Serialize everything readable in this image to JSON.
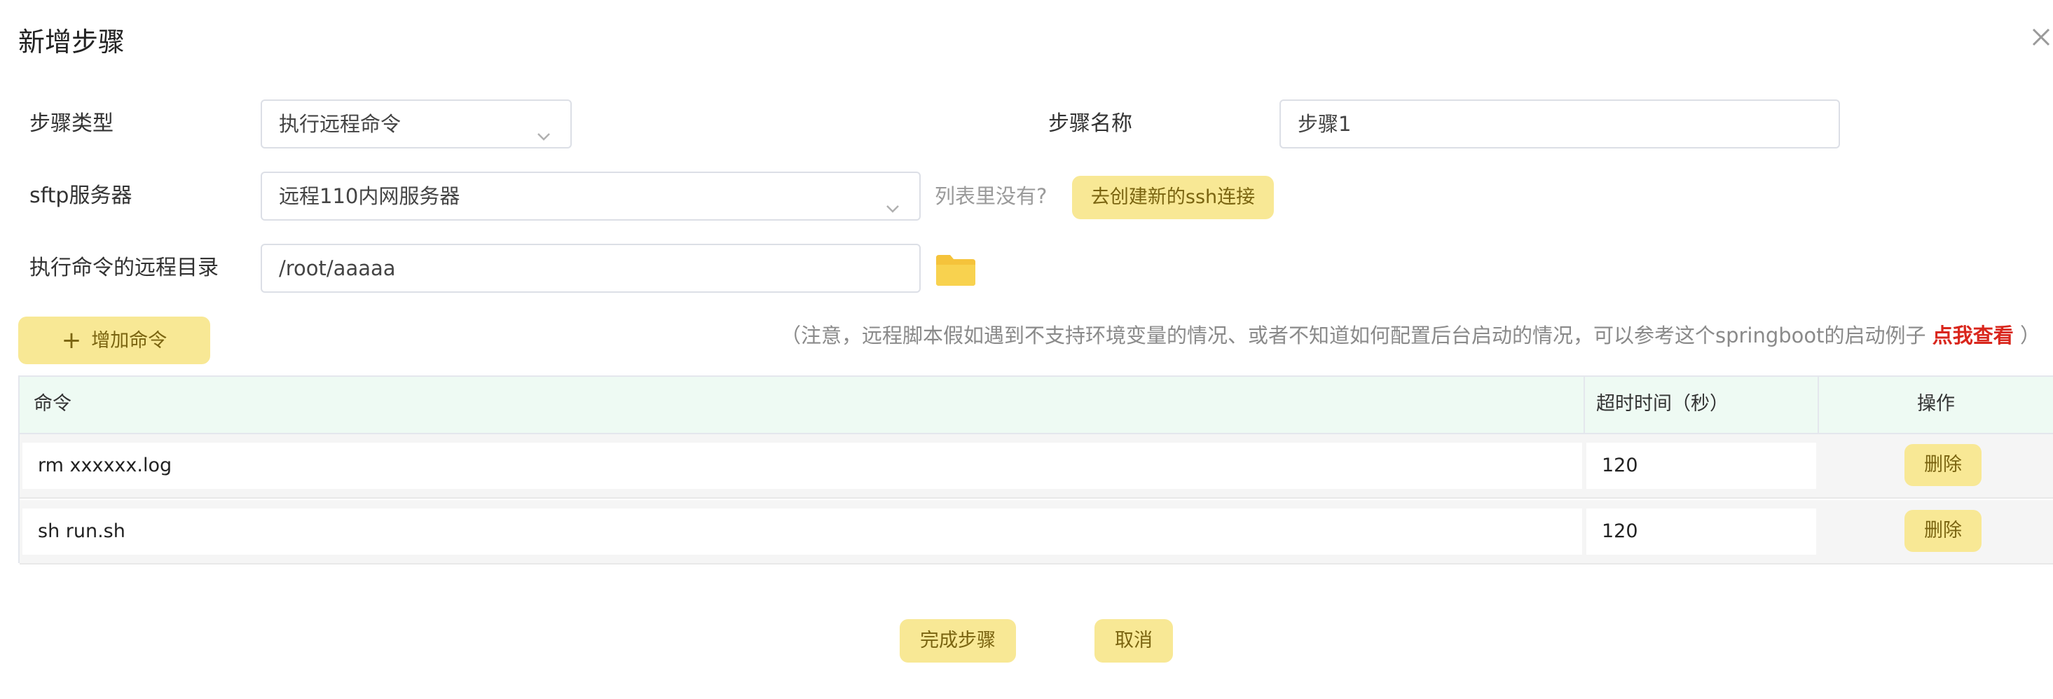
{
  "dialog": {
    "title": "新增步骤",
    "close_icon": "close-icon"
  },
  "form": {
    "step_type": {
      "label": "步骤类型",
      "value": "执行远程命令"
    },
    "step_name": {
      "label": "步骤名称",
      "value": "步骤1"
    },
    "sftp_server": {
      "label": "sftp服务器",
      "value": "远程110内网服务器",
      "hint": "列表里没有?",
      "create_button": "去创建新的ssh连接"
    },
    "remote_dir": {
      "label": "执行命令的远程目录",
      "value": "/root/aaaaa",
      "folder_icon": "folder-icon"
    }
  },
  "add_command_button": {
    "icon": "plus-icon",
    "label": "增加命令"
  },
  "notice": {
    "text": "（注意，远程脚本假如遇到不支持环境变量的情况、或者不知道如何配置后台启动的情况，可以参考这个springboot的启动例子",
    "link": "点我查看",
    "close_paren": "）"
  },
  "table": {
    "columns": [
      "命令",
      "超时时间（秒）",
      "操作"
    ],
    "rows": [
      {
        "command": "rm xxxxxx.log",
        "timeout": "120",
        "action": "删除"
      },
      {
        "command": "sh run.sh",
        "timeout": "120",
        "action": "删除"
      }
    ]
  },
  "footer": {
    "finish_button": "完成步骤",
    "cancel_button": "取消"
  },
  "colors": {
    "accent_yellow": "#f8e895",
    "accent_text": "#7a6410",
    "link_red": "#d9261c",
    "table_header_bg": "#eefaf3",
    "folder": "#f5c33b"
  }
}
